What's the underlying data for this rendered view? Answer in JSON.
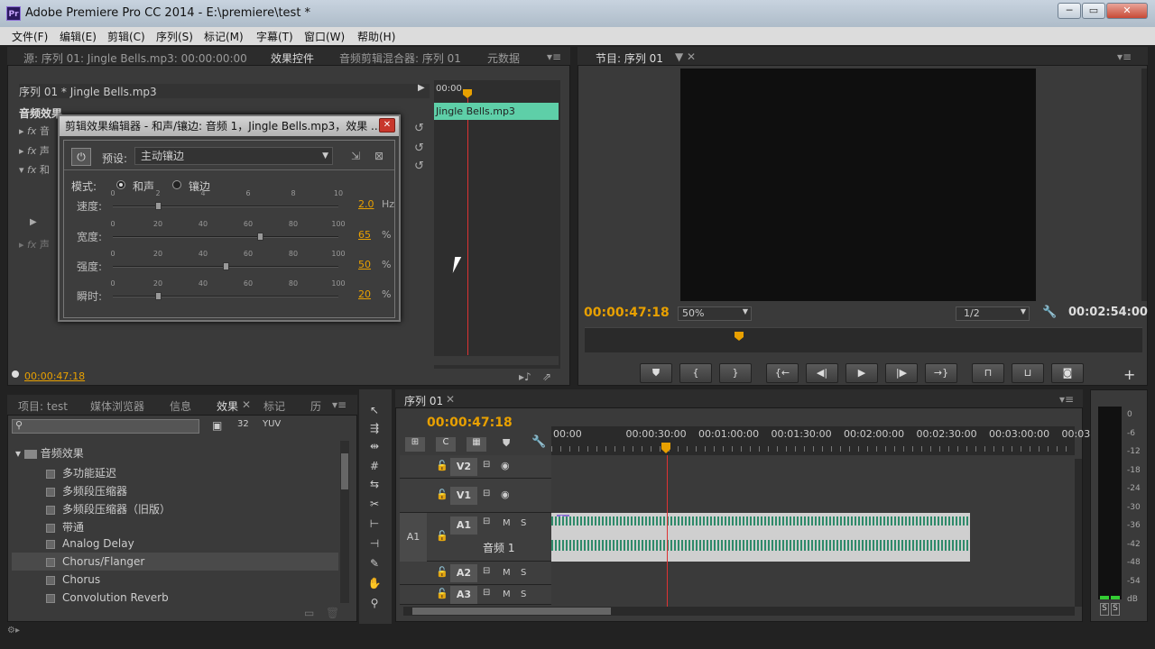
{
  "window": {
    "title": "Adobe Premiere Pro CC 2014 - E:\\premiere\\test *",
    "logo": "Pr",
    "min": "─",
    "restore": "▭",
    "close": "✕"
  },
  "menu": [
    "文件(F)",
    "编辑(E)",
    "剪辑(C)",
    "序列(S)",
    "标记(M)",
    "字幕(T)",
    "窗口(W)",
    "帮助(H)"
  ],
  "source_tabs": [
    "源: 序列 01: Jingle Bells.mp3: 00:00:00:00",
    "效果控件",
    "音频剪辑混合器: 序列 01",
    "元数据"
  ],
  "effect_controls": {
    "clip": "序列 01 * Jingle Bells.mp3",
    "section": "音频效果",
    "mini_time": "00:00",
    "clip_name": "Jingle Bells.mp3",
    "timecode": "00:00:47:18",
    "rows": [
      "音",
      "声",
      "和",
      "声"
    ]
  },
  "dialog": {
    "title": "剪辑效果编辑器 - 和声/镶边: 音频 1，Jingle Bells.mp3，效果 ...",
    "preset_label": "预设:",
    "preset_value": "主动镶边",
    "mode_label": "模式:",
    "mode_opt1": "和声",
    "mode_opt2": "镶边",
    "sliders": [
      {
        "label": "速度:",
        "ticks": [
          "0",
          "2",
          "4",
          "6",
          "8",
          "10"
        ],
        "value": "2.0",
        "unit": "Hz",
        "pos": 0.2
      },
      {
        "label": "宽度:",
        "ticks": [
          "0",
          "20",
          "40",
          "60",
          "80",
          "100"
        ],
        "value": "65",
        "unit": "%",
        "pos": 0.65
      },
      {
        "label": "强度:",
        "ticks": [
          "0",
          "20",
          "40",
          "60",
          "80",
          "100"
        ],
        "value": "50",
        "unit": "%",
        "pos": 0.5
      },
      {
        "label": "瞬时:",
        "ticks": [
          "0",
          "20",
          "40",
          "60",
          "80",
          "100"
        ],
        "value": "20",
        "unit": "%",
        "pos": 0.2
      }
    ]
  },
  "program": {
    "tab": "节目: 序列 01",
    "timecode": "00:00:47:18",
    "zoom": "50%",
    "quality": "1/2",
    "duration": "00:02:54:00"
  },
  "project_tabs": [
    "项目: test",
    "媒体浏览器",
    "信息",
    "效果",
    "标记",
    "历"
  ],
  "effects_tree": {
    "folder": "音频效果",
    "items": [
      "多功能延迟",
      "多频段压缩器",
      "多频段压缩器（旧版）",
      "带通",
      "Analog Delay",
      "Chorus/Flanger",
      "Chorus",
      "Convolution Reverb"
    ],
    "selected": 5
  },
  "timeline": {
    "tab": "序列 01",
    "timecode": "00:00:47:18",
    "ruler": [
      "00:00",
      "00:00:30:00",
      "00:01:00:00",
      "00:01:30:00",
      "00:02:00:00",
      "00:02:30:00",
      "00:03:00:00",
      "00:03:30"
    ],
    "tracks": [
      {
        "name": "V2"
      },
      {
        "name": "V1"
      },
      {
        "name": "A1",
        "src": "A1",
        "label": "音频 1"
      },
      {
        "name": "A2"
      },
      {
        "name": "A3"
      }
    ],
    "m": "M",
    "s": "S"
  },
  "meter": {
    "labels": [
      "0",
      "-6",
      "-12",
      "-18",
      "-24",
      "-30",
      "-36",
      "-42",
      "-48",
      "-54",
      "dB"
    ],
    "solo1": "S",
    "solo2": "S"
  }
}
